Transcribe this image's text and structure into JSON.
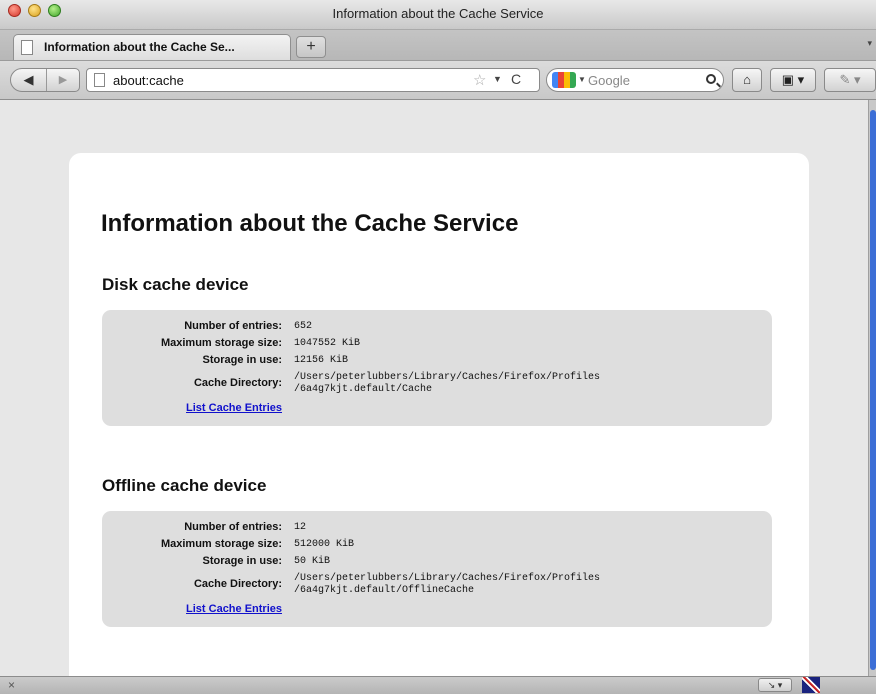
{
  "window": {
    "title": "Information about the Cache Service"
  },
  "tabs": [
    {
      "label": "Information about the Cache Se...",
      "active": true
    }
  ],
  "tab_controls": {
    "new_tab": "+",
    "overflow": "▾"
  },
  "navbar": {
    "back": "◀",
    "forward": "▶",
    "url": "about:cache",
    "bookmark_star": "☆",
    "url_dropdown": "▼",
    "reload": "C",
    "search_engine_dropdown": "▼",
    "search_placeholder": "Google",
    "home": "⌂",
    "bookmarks": "▣ ▾",
    "addons": "✎ ▾"
  },
  "page": {
    "title": "Information about the Cache Service",
    "sections": [
      {
        "heading": "Disk cache device",
        "rows": [
          {
            "label": "Number of entries:",
            "value": "652"
          },
          {
            "label": "Maximum storage size:",
            "value": "1047552 KiB"
          },
          {
            "label": "Storage in use:",
            "value": "12156 KiB"
          },
          {
            "label": "Cache Directory:",
            "value": "/Users/peterlubbers/Library/Caches/Firefox/Profiles",
            "value2": "/6a4g7kjt.default/Cache"
          }
        ],
        "link": "List Cache Entries"
      },
      {
        "heading": "Offline cache device",
        "rows": [
          {
            "label": "Number of entries:",
            "value": "12"
          },
          {
            "label": "Maximum storage size:",
            "value": "512000 KiB"
          },
          {
            "label": "Storage in use:",
            "value": "50 KiB"
          },
          {
            "label": "Cache Directory:",
            "value": "/Users/peterlubbers/Library/Caches/Firefox/Profiles",
            "value2": "/6a4g7kjt.default/OfflineCache"
          }
        ],
        "link": "List Cache Entries"
      }
    ]
  },
  "statusbar": {
    "close": "×",
    "addon": "↘ ▾"
  },
  "colors": {
    "link": "#1111cc",
    "content_bg": "#e7e7e7",
    "info_box_bg": "#dedede",
    "scroll_thumb": "#3c6ed6"
  }
}
